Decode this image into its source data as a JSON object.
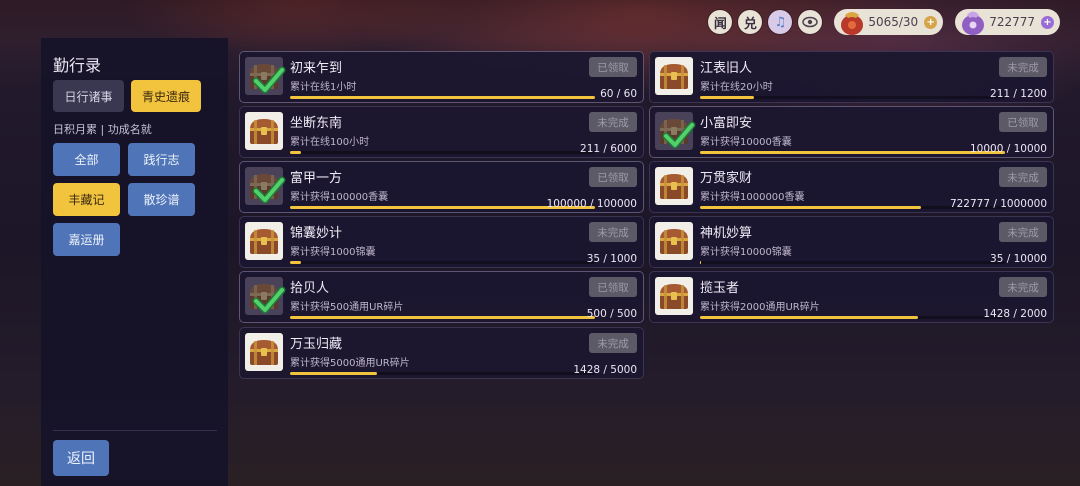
{
  "topbar": {
    "btn_news": "闻",
    "btn_redeem": "兑",
    "currency_a": {
      "value": "5065/30",
      "plus_color": "#d6a54a"
    },
    "currency_b": {
      "value": "722777",
      "plus_color": "#9a6dd6"
    }
  },
  "panel": {
    "title": "勤行录",
    "tabs": [
      {
        "label": "日行诸事",
        "active": false
      },
      {
        "label": "青史遗痕",
        "active": true
      }
    ],
    "subtitle": "日积月累 | 功成名就",
    "categories": [
      {
        "label": "全部",
        "active": false
      },
      {
        "label": "践行志",
        "active": false
      },
      {
        "label": "丰藏记",
        "active": true
      },
      {
        "label": "散珍谱",
        "active": false
      },
      {
        "label": "嘉运册",
        "active": false
      }
    ],
    "back_label": "返回"
  },
  "achievements": [
    {
      "title": "初来乍到",
      "desc": "累计在线1小时",
      "status": "已领取",
      "done": true,
      "progress": 1.0,
      "count": "60 / 60"
    },
    {
      "title": "江表旧人",
      "desc": "累计在线20小时",
      "status": "未完成",
      "done": false,
      "progress": 0.176,
      "count": "211 / 1200"
    },
    {
      "title": "坐断东南",
      "desc": "累计在线100小时",
      "status": "未完成",
      "done": false,
      "progress": 0.035,
      "count": "211 / 6000"
    },
    {
      "title": "小富即安",
      "desc": "累计获得10000香囊",
      "status": "已领取",
      "done": true,
      "progress": 1.0,
      "count": "10000 / 10000"
    },
    {
      "title": "富甲一方",
      "desc": "累计获得100000香囊",
      "status": "已领取",
      "done": true,
      "progress": 1.0,
      "count": "100000 / 100000"
    },
    {
      "title": "万贯家财",
      "desc": "累计获得1000000香囊",
      "status": "未完成",
      "done": false,
      "progress": 0.723,
      "count": "722777 / 1000000"
    },
    {
      "title": "锦囊妙计",
      "desc": "累计获得1000锦囊",
      "status": "未完成",
      "done": false,
      "progress": 0.035,
      "count": "35 / 1000"
    },
    {
      "title": "神机妙算",
      "desc": "累计获得10000锦囊",
      "status": "未完成",
      "done": false,
      "progress": 0.0035,
      "count": "35 / 10000"
    },
    {
      "title": "拾贝人",
      "desc": "累计获得500通用UR碎片",
      "status": "已领取",
      "done": true,
      "progress": 1.0,
      "count": "500 / 500"
    },
    {
      "title": "揽玉者",
      "desc": "累计获得2000通用UR碎片",
      "status": "未完成",
      "done": false,
      "progress": 0.714,
      "count": "1428 / 2000"
    },
    {
      "title": "万玉归藏",
      "desc": "累计获得5000通用UR碎片",
      "status": "未完成",
      "done": false,
      "progress": 0.286,
      "count": "1428 / 5000"
    }
  ]
}
